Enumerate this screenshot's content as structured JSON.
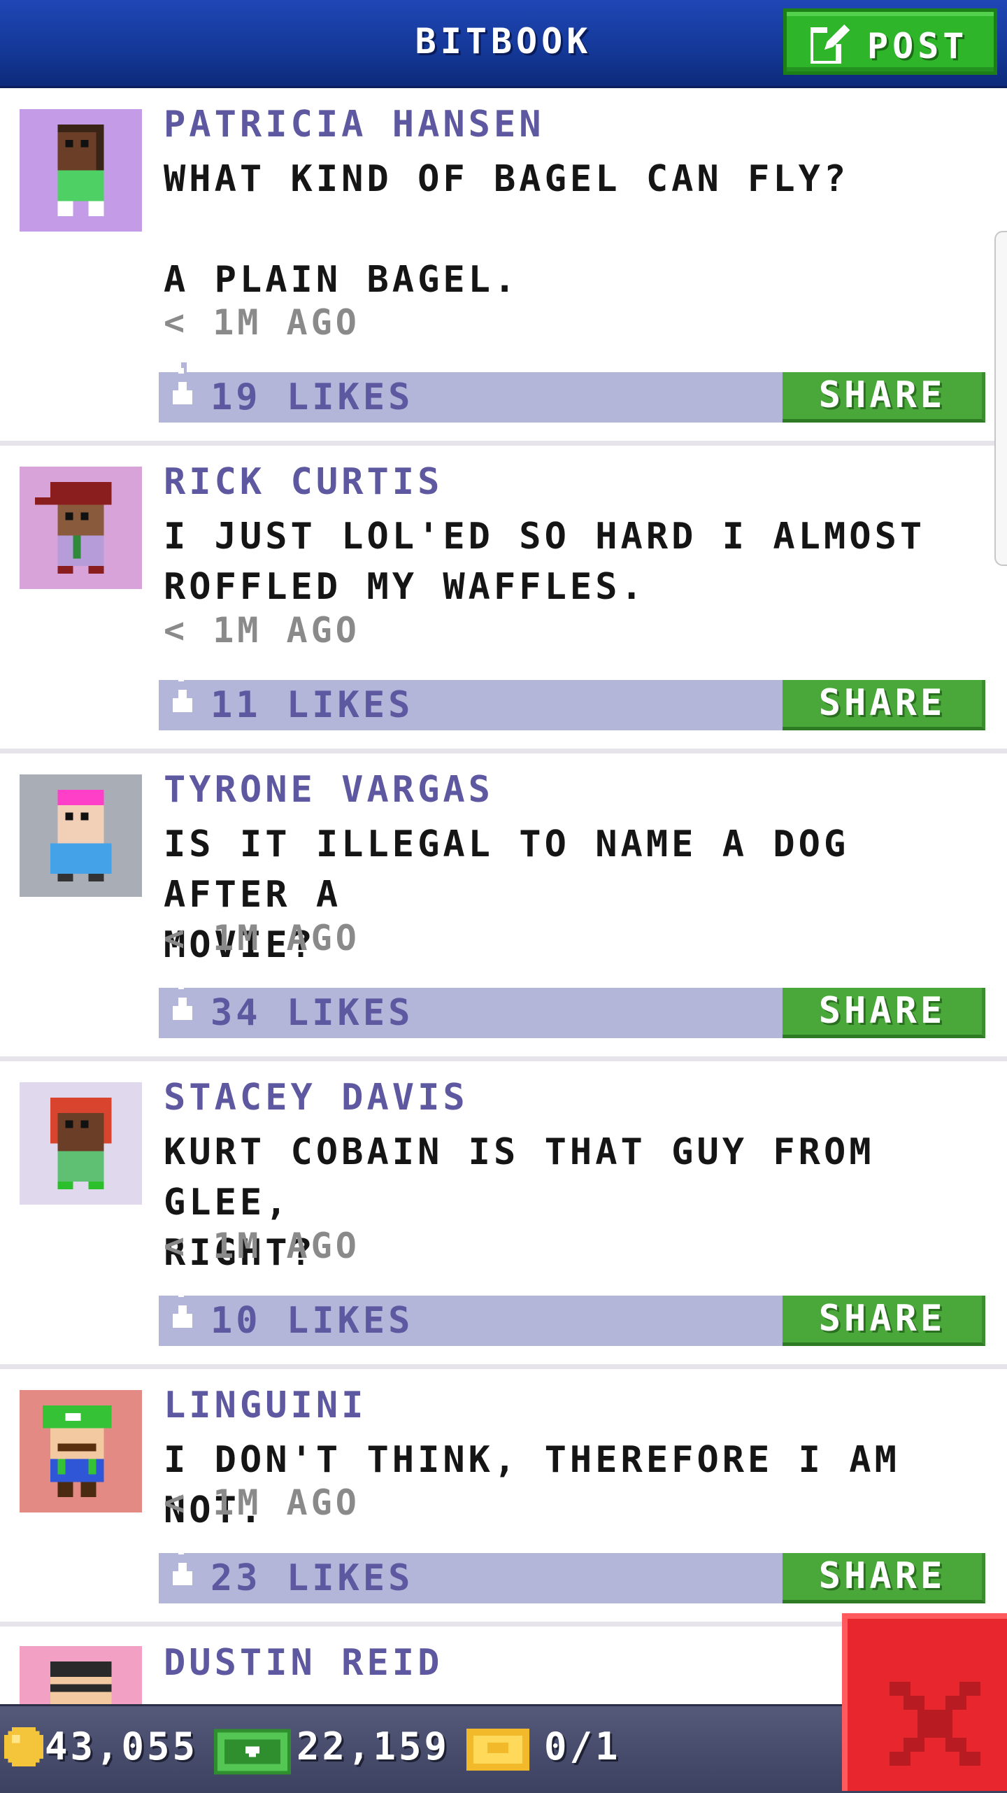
{
  "header": {
    "title": "BITBOOK",
    "post_label": "POST",
    "post_icon": "compose-icon"
  },
  "posts": [
    {
      "name": "PATRICIA HANSEN",
      "text": "WHAT KIND OF BAGEL CAN FLY?\n\nA PLAIN BAGEL.",
      "time": "< 1M AGO",
      "likes": "19 LIKES",
      "share_label": "SHARE",
      "avatar_bg": "#c39be6"
    },
    {
      "name": "RICK CURTIS",
      "text": "I JUST LOL'ED SO HARD I ALMOST\nROFFLED MY WAFFLES.",
      "time": "< 1M AGO",
      "likes": "11 LIKES",
      "share_label": "SHARE",
      "avatar_bg": "#d8a3d8"
    },
    {
      "name": "TYRONE VARGAS",
      "text": "IS IT ILLEGAL TO NAME A DOG AFTER A\nMOVIE?",
      "time": "< 1M AGO",
      "likes": "34 LIKES",
      "share_label": "SHARE",
      "avatar_bg": "#a9adb6"
    },
    {
      "name": "STACEY DAVIS",
      "text": "KURT COBAIN IS THAT GUY FROM GLEE,\nRIGHT?",
      "time": "< 1M AGO",
      "likes": "10 LIKES",
      "share_label": "SHARE",
      "avatar_bg": "#e0d8ec"
    },
    {
      "name": "LINGUINI",
      "text": "I DON'T THINK, THEREFORE I AM NOT.",
      "time": "< 1M AGO",
      "likes": "23 LIKES",
      "share_label": "SHARE",
      "avatar_bg": "#e38a84"
    },
    {
      "name": "DUSTIN REID",
      "text": "",
      "time": "",
      "likes": "",
      "share_label": "",
      "avatar_bg": "#f2a1c4"
    }
  ],
  "bottom_bar": {
    "coins": "43,055",
    "bux": "22,159",
    "tickets": "0/1"
  },
  "colors": {
    "header_blue": "#143897",
    "accent_green": "#4aa83a",
    "like_bar": "#b3b5d9",
    "name_purple": "#5d58a0",
    "close_red": "#e8262d"
  }
}
